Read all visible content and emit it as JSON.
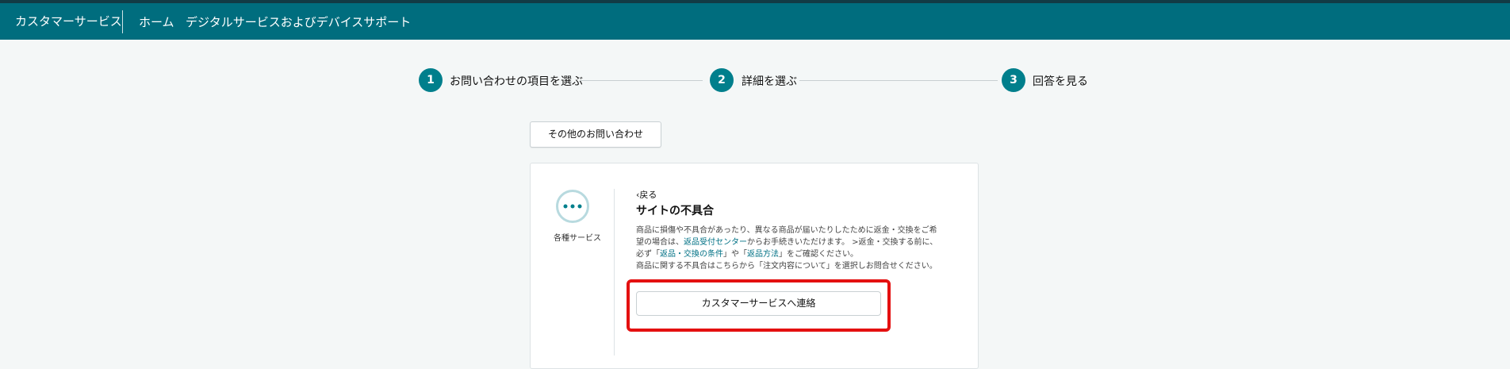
{
  "header": {
    "brand": "カスタマーサービス",
    "nav": [
      "ホーム",
      "デジタルサービスおよびデバイスサポート"
    ]
  },
  "steps": [
    {
      "number": "1",
      "label": "お問い合わせの項目を選ぶ"
    },
    {
      "number": "2",
      "label": "詳細を選ぶ"
    },
    {
      "number": "3",
      "label": "回答を見る"
    }
  ],
  "other_inquiry_label": "その他のお問い合わせ",
  "card": {
    "service_icon": "more-dots-icon",
    "service_label": "各種サービス",
    "back_label": "戻る",
    "title": "サイトの不具合",
    "description": {
      "line1": "商品に損傷や不具合があったり、異なる商品が届いたりしたために返金・交換をご希",
      "line2_pre": "望の場合は、",
      "line2_link": "返品受付センター",
      "line2_post": "からお手続きいただけます。 >返金・交換する前に、",
      "line3_pre": "必ず「",
      "line3_link1": "返品・交換の条件",
      "line3_mid": "」や「",
      "line3_link2": "返品方法",
      "line3_post": "」をご確認ください。",
      "line4": "商品に関する不具合はこちらから「注文内容について」を選択しお問合せください。"
    },
    "contact_button_label": "カスタマーサービスへ連絡"
  },
  "colors": {
    "header_bg": "#006d7e",
    "accent": "#007f8c",
    "highlight": "#e41010",
    "link": "#007185"
  }
}
